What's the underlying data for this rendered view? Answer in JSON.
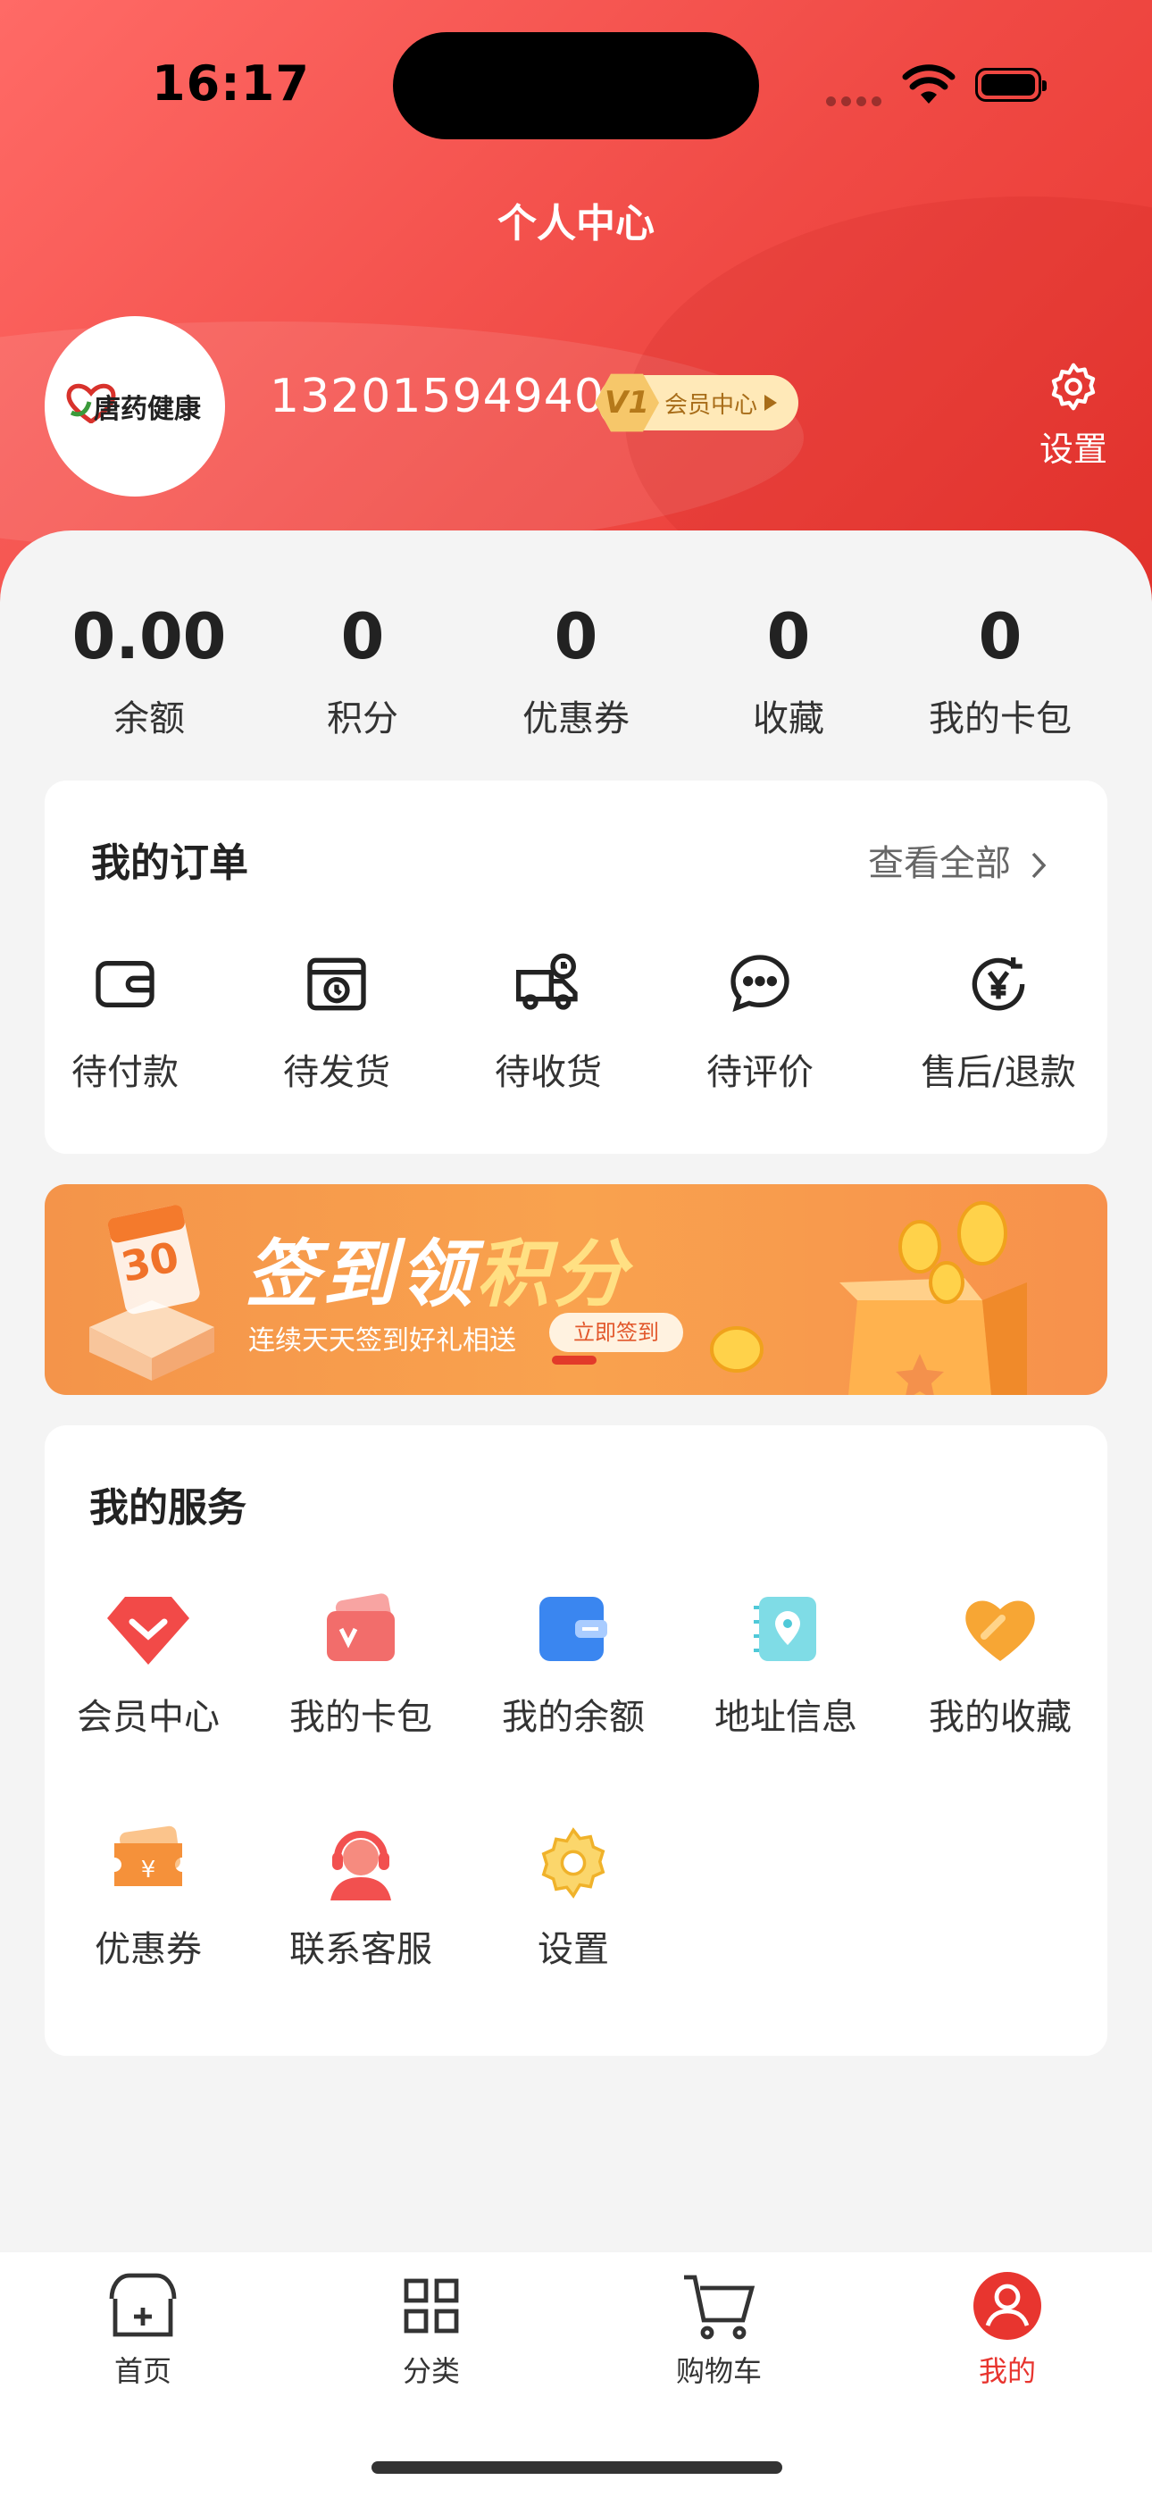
{
  "status_bar": {
    "time": "16:17"
  },
  "header": {
    "title": "个人中心"
  },
  "profile": {
    "avatar_logo_text": "唐药健康",
    "phone": "13201594940",
    "member_level": "V1",
    "member_label": "会员中心",
    "settings_label": "设置"
  },
  "stats": [
    {
      "value": "0.00",
      "label": "余额"
    },
    {
      "value": "0",
      "label": "积分"
    },
    {
      "value": "0",
      "label": "优惠券"
    },
    {
      "value": "0",
      "label": "收藏"
    },
    {
      "value": "0",
      "label": "我的卡包"
    }
  ],
  "orders": {
    "title": "我的订单",
    "view_all": "查看全部",
    "items": [
      {
        "label": "待付款",
        "icon": "wallet-icon"
      },
      {
        "label": "待发货",
        "icon": "package-clock-icon"
      },
      {
        "label": "待收货",
        "icon": "delivery-truck-icon"
      },
      {
        "label": "待评价",
        "icon": "chat-bubble-icon"
      },
      {
        "label": "售后/退款",
        "icon": "yen-refund-icon"
      }
    ]
  },
  "banner": {
    "title_a": "签到领",
    "title_b": "积分",
    "subtitle": "连续天天签到好礼相送",
    "button": "立即签到",
    "calendar_number": "30"
  },
  "services": {
    "title": "我的服务",
    "items": [
      {
        "label": "会员中心",
        "icon": "diamond-icon",
        "color": "#f24a48"
      },
      {
        "label": "我的卡包",
        "icon": "card-wallet-icon",
        "color": "#f26d6b"
      },
      {
        "label": "我的余额",
        "icon": "balance-wallet-icon",
        "color": "#3a86f0"
      },
      {
        "label": "地址信息",
        "icon": "map-location-icon",
        "color": "#4fc9d8"
      },
      {
        "label": "我的收藏",
        "icon": "heart-icon",
        "color": "#f7a634"
      },
      {
        "label": "优惠券",
        "icon": "coupon-icon",
        "color": "#f5913a"
      },
      {
        "label": "联系客服",
        "icon": "customer-service-icon",
        "color": "#f2504f"
      },
      {
        "label": "设置",
        "icon": "settings-gear-icon",
        "color": "#f6c342"
      }
    ]
  },
  "tabbar": {
    "items": [
      {
        "label": "首页",
        "icon": "store-icon",
        "active": false
      },
      {
        "label": "分类",
        "icon": "grid-icon",
        "active": false
      },
      {
        "label": "购物车",
        "icon": "cart-icon",
        "active": false
      },
      {
        "label": "我的",
        "icon": "user-icon",
        "active": true
      }
    ],
    "active_color": "#e8352f"
  }
}
